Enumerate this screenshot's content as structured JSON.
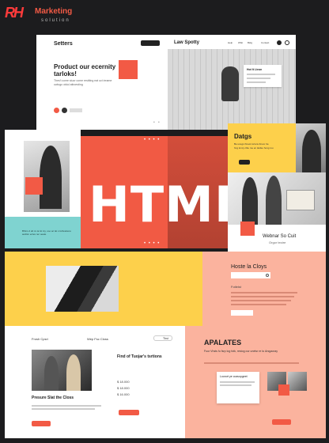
{
  "brand": {
    "logo_letters": "RH",
    "name": "Marketing",
    "tagline": "solution"
  },
  "panel_top_left": {
    "title": "Setters",
    "nav_button": "",
    "headline": "Product our ecernity tarloks!",
    "body": "Thes't come sluor come restiting eat uct ireame owlogo otdul attrcesting",
    "cta": "",
    "dots": [
      "•",
      "•"
    ]
  },
  "panel_top_right": {
    "title": "Law Spotty",
    "nav": [
      "Help",
      "Wbit",
      "Bidg",
      "Contact"
    ],
    "card_title": "Hot It Lieon",
    "card_lines": [
      "",
      "",
      ""
    ]
  },
  "hero": {
    "big_text": "HTML",
    "dots_top": "• • • •",
    "dots_bottom": "• • • •"
  },
  "teal_card": {
    "text": "Bhtns d alt cs ta lst tcy, soo ac lat s tsrtleteleno aodtsn ectes rec oeate"
  },
  "yellow_card": {
    "title": "Datgs",
    "lines": [
      "Be ucegs ihnest torwns ltruvo ha",
      "hng loncy clite me en laidse hong rou"
    ],
    "btn": ""
  },
  "webinar_card": {
    "title": "Webnar So Cuit",
    "subtitle": "Orgor teoire"
  },
  "orange_mid": {
    "title": "Hoste la Cloys",
    "search_placeholder": "",
    "section": "Fotlelst",
    "lines": [
      "",
      "",
      "",
      ""
    ],
    "btn": ""
  },
  "bottom_left": {
    "nav_left": "Frosh Cpsri",
    "nav_mid": "Wep Fsc Closs",
    "nav_right": "Tbst",
    "heading": "Find of Tuojar's tsrtions",
    "prices": [
      "$ 18.000",
      "$ 18.000",
      "$ 16.000"
    ],
    "caption": "Presure Slat the Closs",
    "btn_left": "",
    "btn_right": ""
  },
  "bottom_right": {
    "title": "APALATES",
    "subtitle": "Fuur Vhsts fu fsrp log fotk, restog our unetsr re to Arsgaoray",
    "card_title": "Loorort ye ccasopgeet",
    "btn": ""
  },
  "colors": {
    "accent_red": "#f25a45",
    "yellow": "#fdd04b",
    "salmon": "#fbb39e",
    "teal": "#7fd3d0",
    "background": "#1c1c1e"
  }
}
